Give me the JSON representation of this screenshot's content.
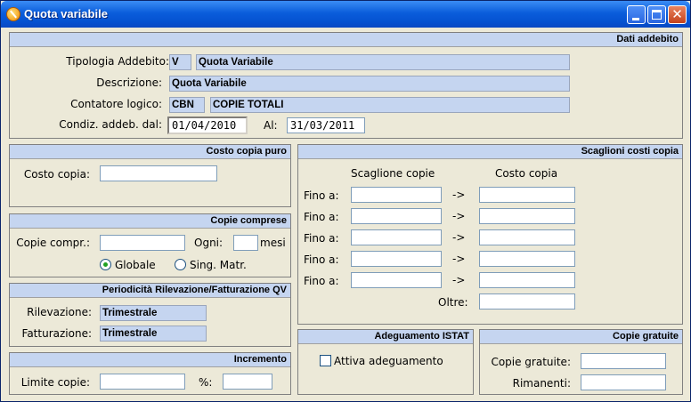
{
  "window": {
    "title": "Quota variabile",
    "controls": {
      "minimize": "minimize-icon",
      "maximize": "maximize-icon",
      "close": "close-icon"
    }
  },
  "dati_addebito": {
    "header": "Dati addebito",
    "tipologia_label": "Tipologia Addebito:",
    "tipologia_code": "V",
    "tipologia_value": "Quota Variabile",
    "descrizione_label": "Descrizione:",
    "descrizione_value": "Quota Variabile",
    "contatore_label": "Contatore logico:",
    "contatore_code": "CBN",
    "contatore_value": "COPIE TOTALI",
    "condiz_label": "Condiz. addeb. dal:",
    "dal_value": "01/04/2010",
    "al_label": "Al:",
    "al_value": "31/03/2011"
  },
  "costo_copia_puro": {
    "header": "Costo copia puro",
    "costo_label": "Costo copia:",
    "costo_value": ""
  },
  "copie_comprese": {
    "header": "Copie comprese",
    "copie_label": "Copie compr.:",
    "copie_value": "",
    "ogni_label": "Ogni:",
    "ogni_value": "",
    "mesi_label": "mesi",
    "radio_globale": "Globale",
    "radio_sing": "Sing. Matr.",
    "selected": "Globale"
  },
  "periodicita": {
    "header": "Periodicità Rilevazione/Fatturazione QV",
    "rilevazione_label": "Rilevazione:",
    "rilevazione_value": "Trimestrale",
    "fatturazione_label": "Fatturazione:",
    "fatturazione_value": "Trimestrale"
  },
  "incremento": {
    "header": "Incremento",
    "limite_label": "Limite copie:",
    "limite_value": "",
    "perc_label": "%:",
    "perc_value": ""
  },
  "scaglioni": {
    "header": "Scaglioni costi copia",
    "col_scaglione": "Scaglione copie",
    "col_costo": "Costo copia",
    "rows": [
      {
        "label": "Fino a:",
        "arrow": "->",
        "scaglione": "",
        "costo": ""
      },
      {
        "label": "Fino a:",
        "arrow": "->",
        "scaglione": "",
        "costo": ""
      },
      {
        "label": "Fino a:",
        "arrow": "->",
        "scaglione": "",
        "costo": ""
      },
      {
        "label": "Fino a:",
        "arrow": "->",
        "scaglione": "",
        "costo": ""
      },
      {
        "label": "Fino a:",
        "arrow": "->",
        "scaglione": "",
        "costo": ""
      }
    ],
    "oltre_label": "Oltre:",
    "oltre_value": ""
  },
  "adeguamento": {
    "header": "Adeguamento ISTAT",
    "checkbox_label": "Attiva adeguamento",
    "checked": false
  },
  "copie_gratuite": {
    "header": "Copie gratuite",
    "copie_label": "Copie gratuite:",
    "copie_value": "",
    "rimanenti_label": "Rimanenti:",
    "rimanenti_value": ""
  },
  "colors": {
    "panel_header": "#c5d5f0",
    "window_bg": "#ece9d8",
    "titlebar": "#0a5ddb"
  }
}
